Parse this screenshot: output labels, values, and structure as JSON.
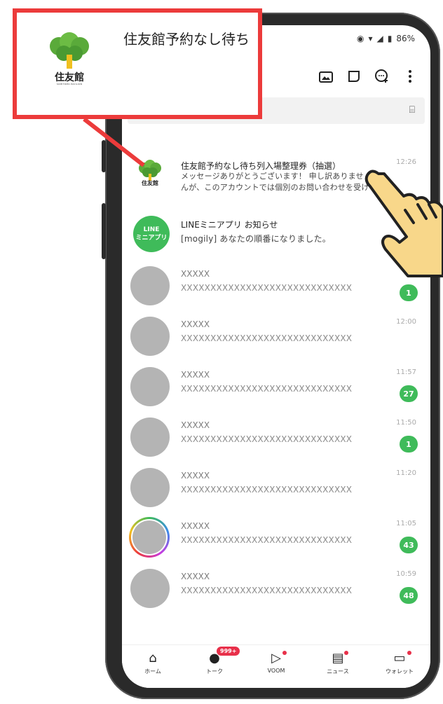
{
  "status_bar": {
    "battery": "86%"
  },
  "callout": {
    "title": "住友館予約なし待ち",
    "logo_text": "住友館",
    "logo_sub": "SUMITOMO PAVILION"
  },
  "chat_list": [
    {
      "name": "住友館予約なし待ち列入場整理券（抽選）",
      "message": "メッセージありがとうございます！ 申し訳ありませんが、このアカウントでは個別のお問い合わせを受け",
      "time": "12:26",
      "badge": "",
      "avatar_kind": "sumitomo",
      "logo_text": "住友館"
    },
    {
      "name": "LINEミニアプリ お知らせ",
      "message": "[mogily] あなたの順番になりました。",
      "time": "",
      "badge": "",
      "avatar_kind": "line",
      "logo_text": "LINE\nミニアプリ"
    },
    {
      "name": "XXXXX",
      "message": "XXXXXXXXXXXXXXXXXXXXXXXXXXXXX",
      "time": "",
      "badge": "1",
      "avatar_kind": "gray"
    },
    {
      "name": "XXXXX",
      "message": "XXXXXXXXXXXXXXXXXXXXXXXXXXXXX",
      "time": "12:00",
      "badge": "",
      "avatar_kind": "gray"
    },
    {
      "name": "XXXXX",
      "message": "XXXXXXXXXXXXXXXXXXXXXXXXXXXXX",
      "time": "11:57",
      "badge": "27",
      "avatar_kind": "gray"
    },
    {
      "name": "XXXXX",
      "message": "XXXXXXXXXXXXXXXXXXXXXXXXXXXXX",
      "time": "11:50",
      "badge": "1",
      "avatar_kind": "gray"
    },
    {
      "name": "XXXXX",
      "message": "XXXXXXXXXXXXXXXXXXXXXXXXXXXXX",
      "time": "11:20",
      "badge": "",
      "avatar_kind": "gray"
    },
    {
      "name": "XXXXX",
      "message": "XXXXXXXXXXXXXXXXXXXXXXXXXXXXX",
      "time": "11:05",
      "badge": "43",
      "avatar_kind": "story"
    },
    {
      "name": "XXXXX",
      "message": "XXXXXXXXXXXXXXXXXXXXXXXXXXXXX",
      "time": "10:59",
      "badge": "48",
      "avatar_kind": "gray"
    }
  ],
  "bottom_nav": [
    {
      "label": "ホーム",
      "icon": "home-icon"
    },
    {
      "label": "トーク",
      "icon": "chat-icon",
      "badge": "999+"
    },
    {
      "label": "VOOM",
      "icon": "voom-icon"
    },
    {
      "label": "ニュース",
      "icon": "news-icon"
    },
    {
      "label": "ウォレット",
      "icon": "wallet-icon"
    }
  ],
  "colors": {
    "accent_green": "#3fbb5a",
    "callout_red": "#ec3b3b",
    "badge_red": "#e8304a"
  }
}
